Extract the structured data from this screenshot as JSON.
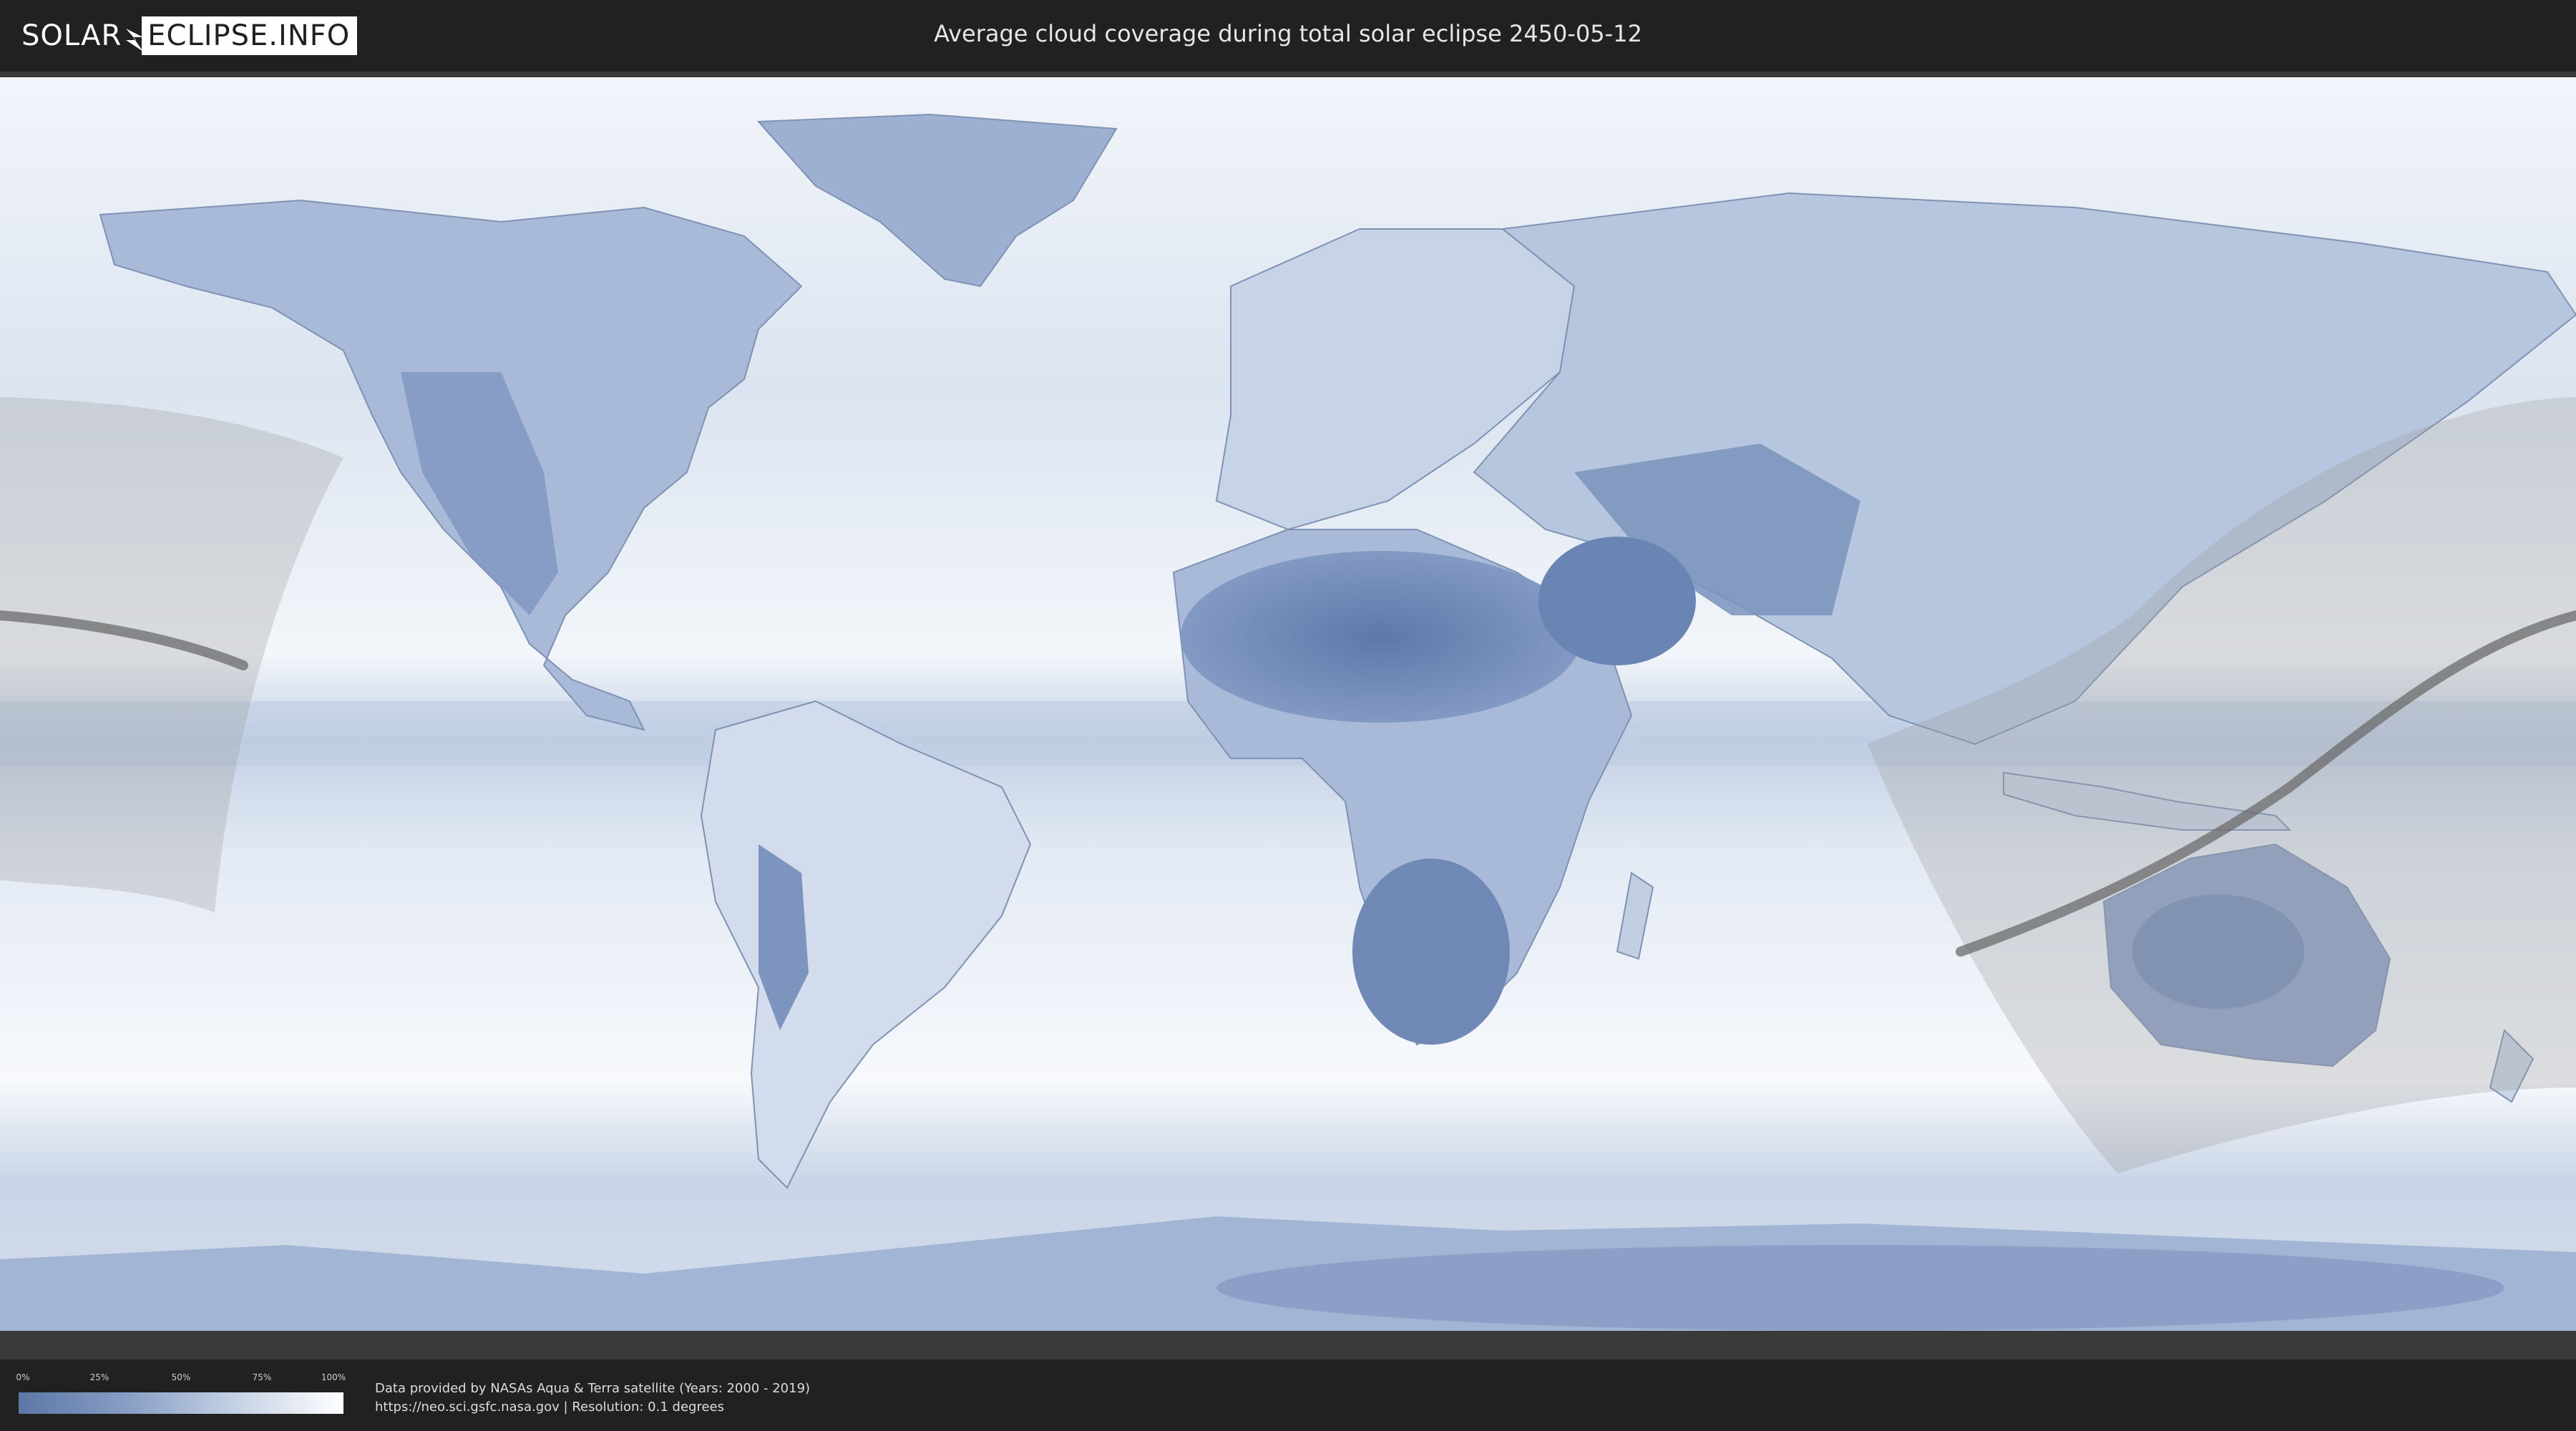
{
  "header": {
    "logo_left": "SOLAR",
    "logo_right": "ECLIPSE.INFO",
    "title": "Average cloud coverage during total solar eclipse 2450-05-12"
  },
  "legend": {
    "ticks": [
      "0%",
      "25%",
      "50%",
      "75%",
      "100%"
    ],
    "colors": {
      "low": "#5c76a6",
      "high": "#ffffff"
    }
  },
  "credits": {
    "line1": "Data provided by NASAs Aqua & Terra satellite (Years: 2000 - 2019)",
    "line2": "https://neo.sci.gsfc.nasa.gov | Resolution: 0.1 degrees"
  },
  "colors": {
    "land_cloudy": "#dfe7f2",
    "land_clear": "#6f88b6",
    "ocean": "#e8eef6",
    "eclipse_zone": "#9a9a9a",
    "eclipse_path": "#6b6b6b"
  }
}
